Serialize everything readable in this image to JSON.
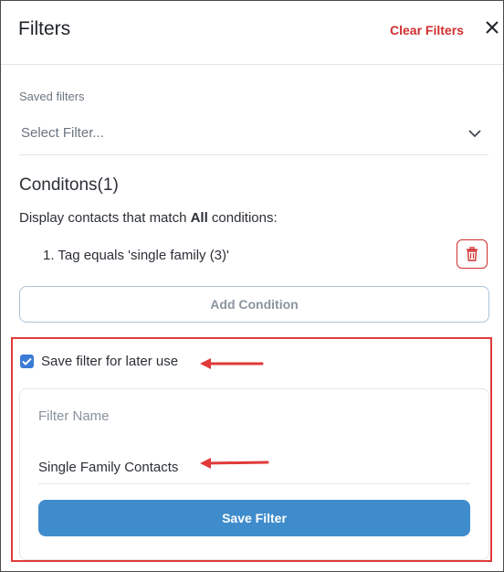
{
  "header": {
    "title": "Filters",
    "clear_label": "Clear Filters",
    "close_icon": "close-icon"
  },
  "saved_filters": {
    "label": "Saved filters",
    "placeholder": "Select Filter...",
    "chevron_icon": "chevron-down-icon"
  },
  "conditions": {
    "title": "Conditons(1)",
    "match_prefix": "Display contacts that match ",
    "match_bold": "All",
    "match_suffix": " conditions:",
    "items": [
      {
        "text": "1. Tag equals 'single family (3)'"
      }
    ],
    "delete_icon": "trash-icon",
    "add_label": "Add Condition"
  },
  "save_section": {
    "checkbox_checked": true,
    "checkbox_label": "Save filter for later use",
    "name_label": "Filter Name",
    "name_value": "Single Family Contacts",
    "save_button_label": "Save Filter"
  },
  "colors": {
    "accent_red": "#d12e2e",
    "annotation_red": "#e03a3a",
    "primary_blue": "#3f8ccc",
    "checkbox_blue": "#3a7bd5"
  }
}
